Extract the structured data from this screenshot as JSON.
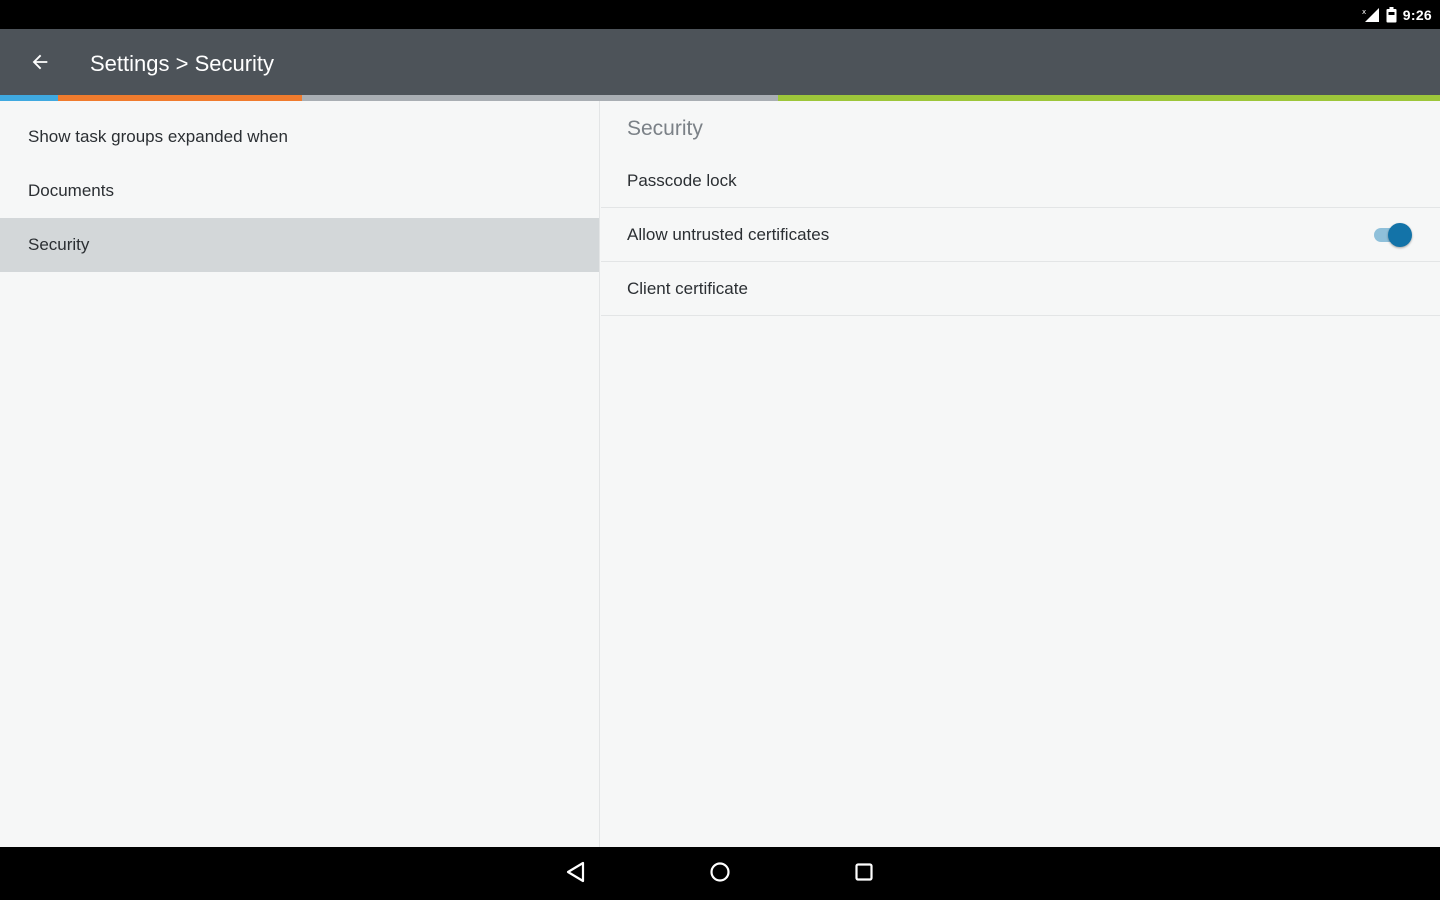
{
  "status_bar": {
    "time": "9:26",
    "icons": [
      "signal-no-data-icon",
      "battery-icon"
    ]
  },
  "app_bar": {
    "title": "Settings > Security",
    "back_icon": "arrow-back-icon"
  },
  "accent_colors": [
    "#3fa9e0",
    "#f07b2d",
    "#a9aeb3",
    "#9dc63a"
  ],
  "left_nav": {
    "items": [
      {
        "label": "Show task groups expanded when",
        "selected": false
      },
      {
        "label": "Documents",
        "selected": false
      },
      {
        "label": "Security",
        "selected": true
      }
    ]
  },
  "security": {
    "header": "Security",
    "items": [
      {
        "label": "Passcode lock"
      },
      {
        "label": "Allow untrusted certificates",
        "toggle": true
      },
      {
        "label": "Client certificate"
      }
    ]
  },
  "colors": {
    "app_bar": "#4d5359",
    "toggle_on": "#1373a8",
    "selected_row": "#d3d7d9"
  },
  "nav_bar": {
    "buttons": [
      "back-triangle-icon",
      "home-circle-icon",
      "recents-square-icon"
    ]
  }
}
